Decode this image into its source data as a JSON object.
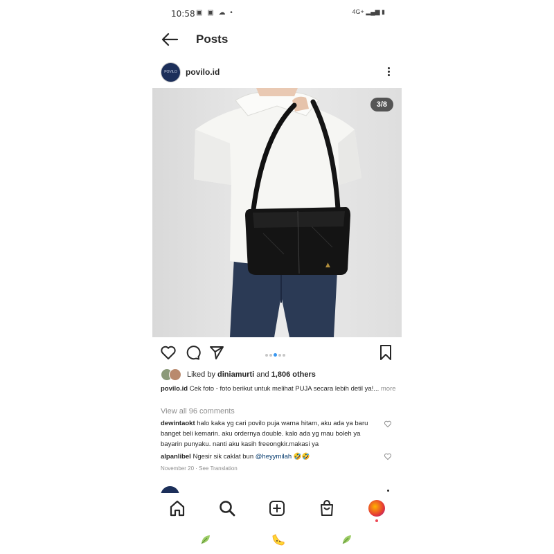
{
  "status_bar": {
    "time": "10:58",
    "right": "4G+"
  },
  "header": {
    "title": "Posts"
  },
  "post": {
    "username": "povilo.id",
    "avatar_text": "POVILO",
    "image_counter": "3/8",
    "carousel": {
      "total": 5,
      "active": 2
    },
    "likes": {
      "prefix": "Liked by ",
      "user": "diniamurti",
      "middle": " and ",
      "count": "1,806 others"
    },
    "caption": {
      "user": "povilo.id",
      "text": " Cek foto - foto berikut untuk melihat PUJA secara lebih detil ya!...",
      "more": " more"
    },
    "view_all": "View all 96 comments",
    "comments": [
      {
        "user": "dewintaokt",
        "text": " halo kaka yg cari povilo puja warna hitam, aku ada ya baru banget beli kemarin. aku ordernya double. kalo ada yg mau boleh ya bayarin punyaku. nanti aku kasih freeongkir.makasi ya"
      },
      {
        "user": "alpanlibel",
        "text": " Ngesir sik caklat bun ",
        "mention": "@heyymilah",
        "emoji": " 🤣🤣"
      }
    ],
    "date": "November 20 · See Translation"
  },
  "icons": {
    "back": "arrow-left-icon",
    "more": "more-vertical-icon",
    "like": "heart-icon",
    "comment": "comment-icon",
    "share": "send-icon",
    "save": "bookmark-icon",
    "home": "home-icon",
    "search": "search-icon",
    "create": "add-post-icon",
    "shop": "shop-icon",
    "profile": "profile-avatar-icon"
  },
  "colors": {
    "accent": "#3897f0",
    "text": "#262626",
    "muted": "#8e8e8e",
    "avatar_bg": "#1c2f5a"
  }
}
